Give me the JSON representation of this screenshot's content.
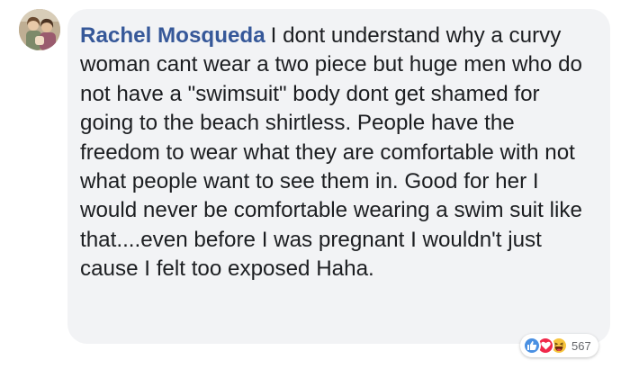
{
  "comment": {
    "author": "Rachel Mosqueda",
    "body": "I dont understand why a curvy woman cant wear a two piece but huge men who do not have a \"swimsuit\" body dont get shamed for going to the beach shirtless. People have the freedom to wear what they are comfortable with not what people want to see them in. Good for her I would never be comfortable wearing a swim suit like that....even before I was pregnant I wouldn't just cause I felt too exposed Haha.",
    "reactions": {
      "icons": [
        "like-icon",
        "love-icon",
        "haha-icon"
      ],
      "count": "567"
    }
  },
  "colors": {
    "author": "#365899",
    "bubble": "#f2f3f5",
    "text": "#1c1e21",
    "like": "#4a90e2",
    "love": "#f0284a",
    "haha": "#f7c43d"
  }
}
